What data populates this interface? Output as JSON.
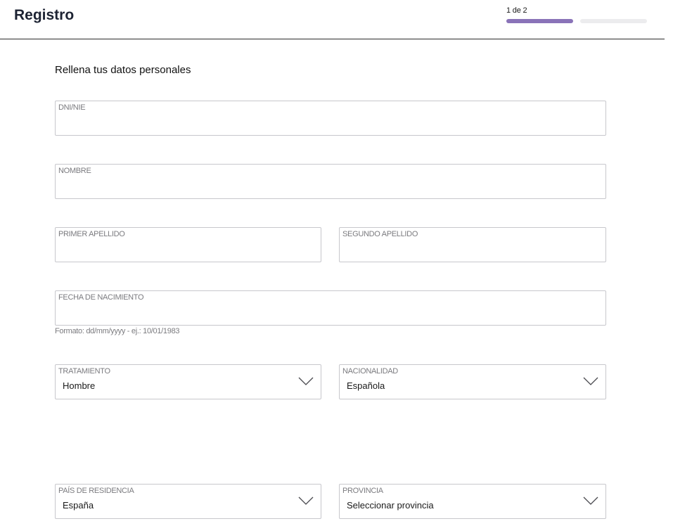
{
  "header": {
    "title": "Registro",
    "step_label": "1 de 2",
    "step_current": 1,
    "step_total": 2,
    "accent_color": "#8a73b8"
  },
  "form": {
    "section_title": "Rellena tus datos personales",
    "dni": {
      "label": "DNI/NIE",
      "value": ""
    },
    "nombre": {
      "label": "NOMBRE",
      "value": ""
    },
    "primer_apellido": {
      "label": "PRIMER APELLIDO",
      "value": ""
    },
    "segundo_apellido": {
      "label": "SEGUNDO APELLIDO",
      "value": ""
    },
    "fecha_nacimiento": {
      "label": "FECHA DE NACIMIENTO",
      "value": "",
      "hint": "Formato: dd/mm/yyyy - ej.: 10/01/1983"
    },
    "tratamiento": {
      "label": "TRATAMIENTO",
      "value": "Hombre",
      "icon": "chevron-down-icon"
    },
    "nacionalidad": {
      "label": "NACIONALIDAD",
      "value": "Española",
      "icon": "chevron-down-icon"
    },
    "pais_residencia": {
      "label": "PAÍS DE RESIDENCIA",
      "value": "España",
      "icon": "chevron-down-icon"
    },
    "provincia": {
      "label": "PROVINCIA",
      "value": "Seleccionar provincia",
      "icon": "chevron-down-icon"
    }
  }
}
